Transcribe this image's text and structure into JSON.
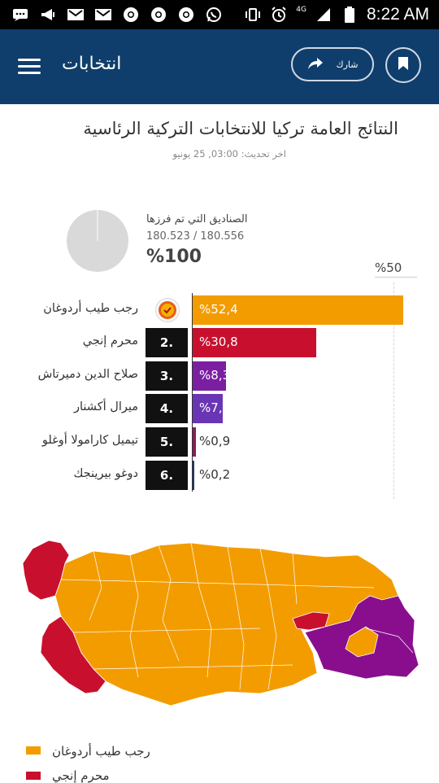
{
  "status_bar": {
    "time": "8:22 AM",
    "network": "4G",
    "icons": [
      "message-icon",
      "megaphone-icon",
      "gmail-icon",
      "gmail-icon",
      "chrome-icon",
      "chrome-icon",
      "chrome-icon",
      "whatsapp-icon",
      "vibrate-icon",
      "alarm-icon",
      "signal-icon",
      "battery-icon"
    ]
  },
  "app_bar": {
    "title": "انتخابات",
    "share_label": "شارك",
    "background": "#0f3e6c"
  },
  "page": {
    "title": "النتائج العامة تركيا للانتخابات التركية الرئاسية",
    "updated": "اخر تحديث: 03:00, 25 يونيو"
  },
  "counted": {
    "label": "الصناديق التي تم فرزها",
    "count": "180.523 / 180.556",
    "percent_text": "%100",
    "fraction_counted": 0.9998
  },
  "threshold": {
    "label": "%50"
  },
  "candidates": [
    {
      "name": "رجب طيب أردوغان",
      "rank": "",
      "percent": 52.4,
      "label": "%52,4",
      "color": "#f39c00"
    },
    {
      "name": "محرم إنجي",
      "rank": "2.",
      "percent": 30.8,
      "label": "%30,8",
      "color": "#c8102e"
    },
    {
      "name": "صلاح الدين دميرتاش",
      "rank": "3.",
      "percent": 8.3,
      "label": "%8,3",
      "color": "#7b1fa2"
    },
    {
      "name": "ميرال أكشنار",
      "rank": "4.",
      "percent": 7.4,
      "label": "%7,4",
      "color": "#6a35b5"
    },
    {
      "name": "تيميل كارامولا أوغلو",
      "rank": "5.",
      "percent": 0.9,
      "label": "%0,9",
      "color": "#8e1b5a"
    },
    {
      "name": "دوغو بيرينجك",
      "rank": "6.",
      "percent": 0.2,
      "label": "%0,2",
      "color": "#1b3a7a"
    }
  ],
  "map": {
    "colors": {
      "erdogan": "#f39c00",
      "ince": "#c8102e",
      "demirtas": "#880e8e"
    }
  },
  "legend": [
    {
      "label": "رجب طيب أردوغان",
      "color": "#f39c00"
    },
    {
      "label": "محرم إنجي",
      "color": "#c8102e"
    }
  ]
}
